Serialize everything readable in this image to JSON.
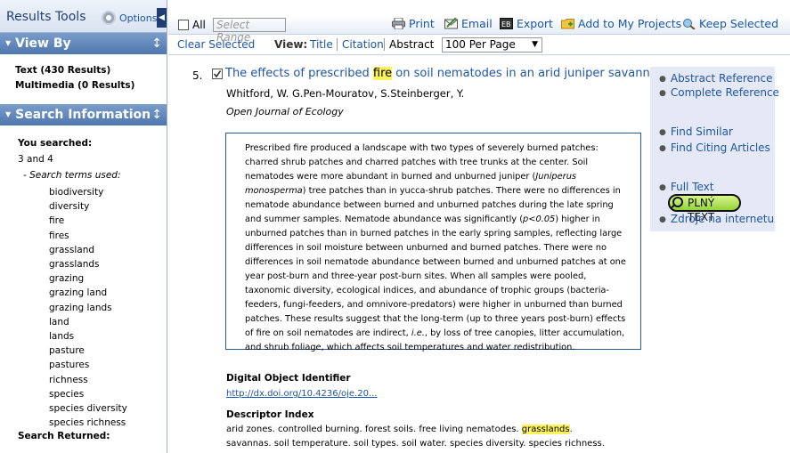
{
  "sidebar": {
    "title": "Results Tools",
    "options_label": "Options",
    "collapse_glyph": "◀",
    "view_by": {
      "heading": "View By",
      "items": [
        "Text (430 Results)",
        "Multimedia (0 Results)"
      ]
    },
    "search_info": {
      "heading": "Search Information",
      "you_searched_label": "You searched:",
      "query": "3 and 4",
      "terms_label": "- Search terms used:",
      "terms": [
        "biodiversity",
        "diversity",
        "fire",
        "fires",
        "grassland",
        "grasslands",
        "grazing",
        "grazing land",
        "grazing lands",
        "land",
        "lands",
        "pasture",
        "pastures",
        "richness",
        "species",
        "species diversity",
        "species richness"
      ],
      "returned_label": "Search Returned:"
    }
  },
  "toolbar": {
    "all_label": "All",
    "range_placeholder": "Select Range",
    "print": "Print",
    "email": "Email",
    "export": "Export",
    "add_projects": "Add to My Projects",
    "keep_selected": "Keep Selected",
    "clear_selected": "Clear Selected",
    "view_label": "View:",
    "view_title": "Title",
    "view_citation": "Citation",
    "view_abstract": "Abstract",
    "per_page": "100 Per Page"
  },
  "result": {
    "number": "5.",
    "title_pre": "The effects of prescribed ",
    "title_hl": "fire",
    "title_post": " on soil nematodes in an arid juniper savanna.",
    "authors": "Whitford, W. G.Pen-Mouratov, S.Steinberger, Y.",
    "journal": "Open Journal of Ecology",
    "abstract": {
      "p1": "Prescribed fire produced a landscape with two types of severely burned patches: charred shrub patches and charred patches with tree trunks at the center. Soil nematodes were more abundant in burned and unburned juniper (",
      "species": "Juniperus monosperma",
      "p2": ") tree patches than in yucca-shrub patches. There were no differences in nematode abundance between burned and unburned patches during the late spring and summer samples. Nematode abundance was significantly (",
      "pval": "p<0.05",
      "p3": ") higher in unburned patches than in burned patches in the early spring samples, reflecting large differences in soil moisture between unburned and burned patches. There were no differences in soil nematode abundance between burned and unburned patches at one year post-burn and three-year post-burn sites. When all samples were pooled, taxonomic diversity, ecological indices, and abundance of trophic groups (bacteria-feeders, fungi-feeders, and omnivore-predators) were higher in unburned than burned patches. These results suggest that the long-term (up to three years post-burn) effects of fire on soil nematodes are indirect, ",
      "ie": "i.e.",
      "p4": ", by loss of tree canopies, litter accumulation, and shrub foliage, which affects soil temperatures and water redistribution."
    },
    "doi_label": "Digital Object Identifier",
    "doi": "http://dx.doi.org/10.4236/oje.20...",
    "descriptor_label": "Descriptor Index",
    "descriptors_pre": "arid zones. controlled burning. forest soils. free living nematodes. ",
    "descriptors_hl": "grasslands",
    "descriptors_post": ". savannas. soil temperature. soil types. soil water. species diversity. species richness. spring. summer."
  },
  "links": {
    "abstract_ref": "Abstract Reference",
    "complete_ref": "Complete Reference",
    "find_similar": "Find Similar",
    "find_citing": "Find Citing Articles",
    "full_text": "Full Text",
    "plny_text": "PLNÝ TEXT",
    "zdroje": "Zdroje na internetu"
  },
  "colors": {
    "link": "#1c56a3",
    "panel_header": "#4f77ad",
    "highlight": "#fbf25c",
    "side_panel": "#e5e8f5"
  }
}
